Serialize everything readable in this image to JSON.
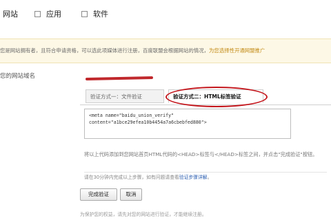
{
  "site_types": [
    {
      "label": "网站"
    },
    {
      "label": "应用"
    },
    {
      "label": "软件"
    }
  ],
  "notice": {
    "text": "您是网站拥有者，且符合申请资格，可以选此项媒体进行注册，百度联盟会根据网站的情况，",
    "highlight": "为您选择性开通网盟推广"
  },
  "domain_field": {
    "label": "您的网站域名",
    "value": ""
  },
  "tabs": [
    {
      "label": "验证方式一：文件验证"
    },
    {
      "label": "验证方式二：HTML标签验证"
    }
  ],
  "code": {
    "line1": "<meta name=\"baidu_union_verify\"",
    "line2": "content=\"a1bce29efea10b4454a7a6cbebfed880\">"
  },
  "instruction": "将以上代码添加到您网站首页HTML代码的<HEAD>标签与</HEAD>标签之间，并点击\"完成验证\"按钮。",
  "time_note": {
    "prefix": "请在30分钟内完成以上步骤，如有问题请查看",
    "link": "验证步骤详解",
    "suffix": "。"
  },
  "buttons": {
    "done": "完成验证",
    "cancel": "取消"
  },
  "footer": "为保护您的权益，请先对您的网站进行验证，才能继续注册。",
  "colors": {
    "annotation_red": "#c4161c",
    "notice_bg": "#fdf8e6",
    "link_blue": "#2a5db0"
  }
}
